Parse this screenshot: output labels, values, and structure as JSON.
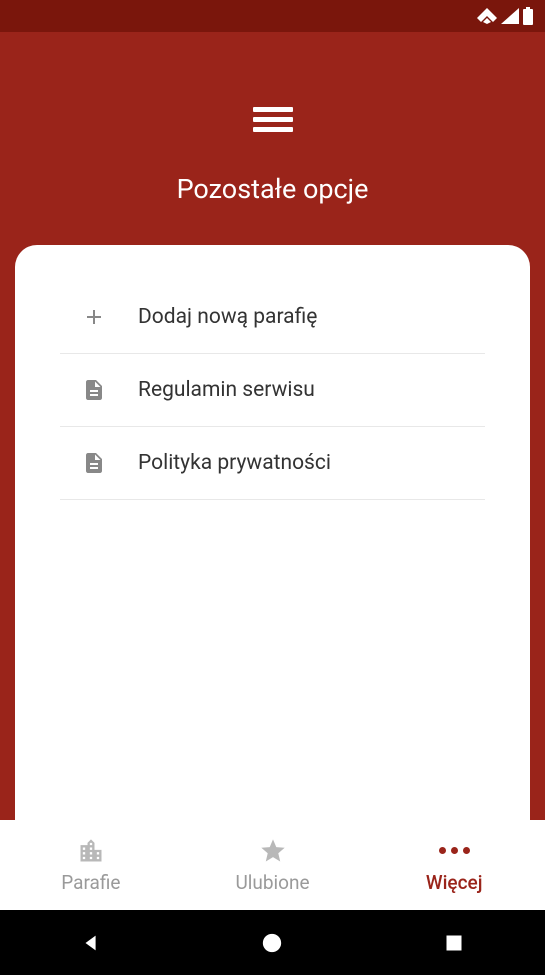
{
  "header": {
    "title": "Pozostałe opcje"
  },
  "options": [
    {
      "icon": "plus",
      "label": "Dodaj nową parafię"
    },
    {
      "icon": "document",
      "label": "Regulamin serwisu"
    },
    {
      "icon": "document",
      "label": "Polityka prywatności"
    }
  ],
  "bottomNav": [
    {
      "icon": "building",
      "label": "Parafie",
      "active": false
    },
    {
      "icon": "star",
      "label": "Ulubione",
      "active": false
    },
    {
      "icon": "dots",
      "label": "Więcej",
      "active": true
    }
  ]
}
